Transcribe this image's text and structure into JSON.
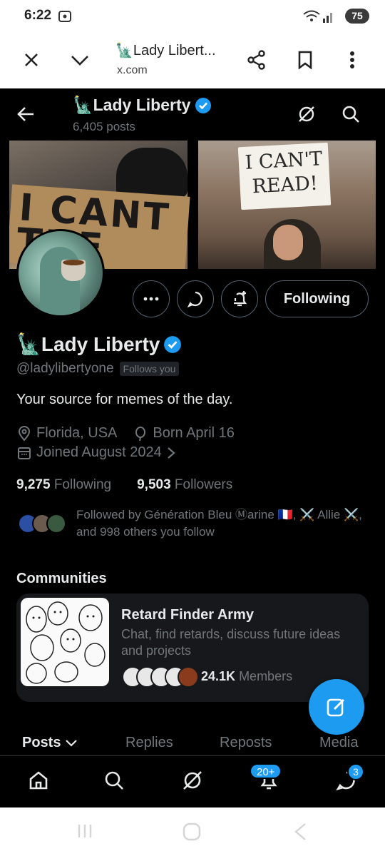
{
  "status_bar": {
    "time": "6:22",
    "battery": "75"
  },
  "browser": {
    "tab_title": "🗽Lady Libert...",
    "url": "x.com"
  },
  "header": {
    "name": "🗽Lady Liberty",
    "posts_count": "6,405 posts"
  },
  "banner": {
    "left_sign_text": "I CANT THE",
    "right_sign_text": "I CAN'T READ!"
  },
  "profile": {
    "display_name": "🗽Lady Liberty",
    "handle": "@ladylibertyone",
    "follows_you": "Follows you",
    "bio": "Your source for memes of the day.",
    "location": "Florida, USA",
    "birthday": "Born April 16",
    "joined": "Joined August 2024",
    "following_count": "9,275",
    "following_label": "Following",
    "followers_count": "9,503",
    "followers_label": "Followers",
    "followed_by_text": "Followed by Génération Bleu Ⓜarine 🇫🇷, ⚔️ Allie ⚔️, and 998 others you follow",
    "follow_button": "Following"
  },
  "communities": {
    "title": "Communities",
    "card": {
      "name": "Retard Finder Army",
      "description": "Chat, find retards, discuss future ideas and projects",
      "members_count": "24.1K",
      "members_label": "Members"
    }
  },
  "tabs": [
    "Posts",
    "Replies",
    "Reposts",
    "Media"
  ],
  "bottom_nav": {
    "notifications_badge": "20+",
    "messages_badge": "3"
  },
  "colors": {
    "accent": "#1d9bf0",
    "background": "#000000",
    "text_primary": "#e7e9ea",
    "text_secondary": "#71767b"
  }
}
